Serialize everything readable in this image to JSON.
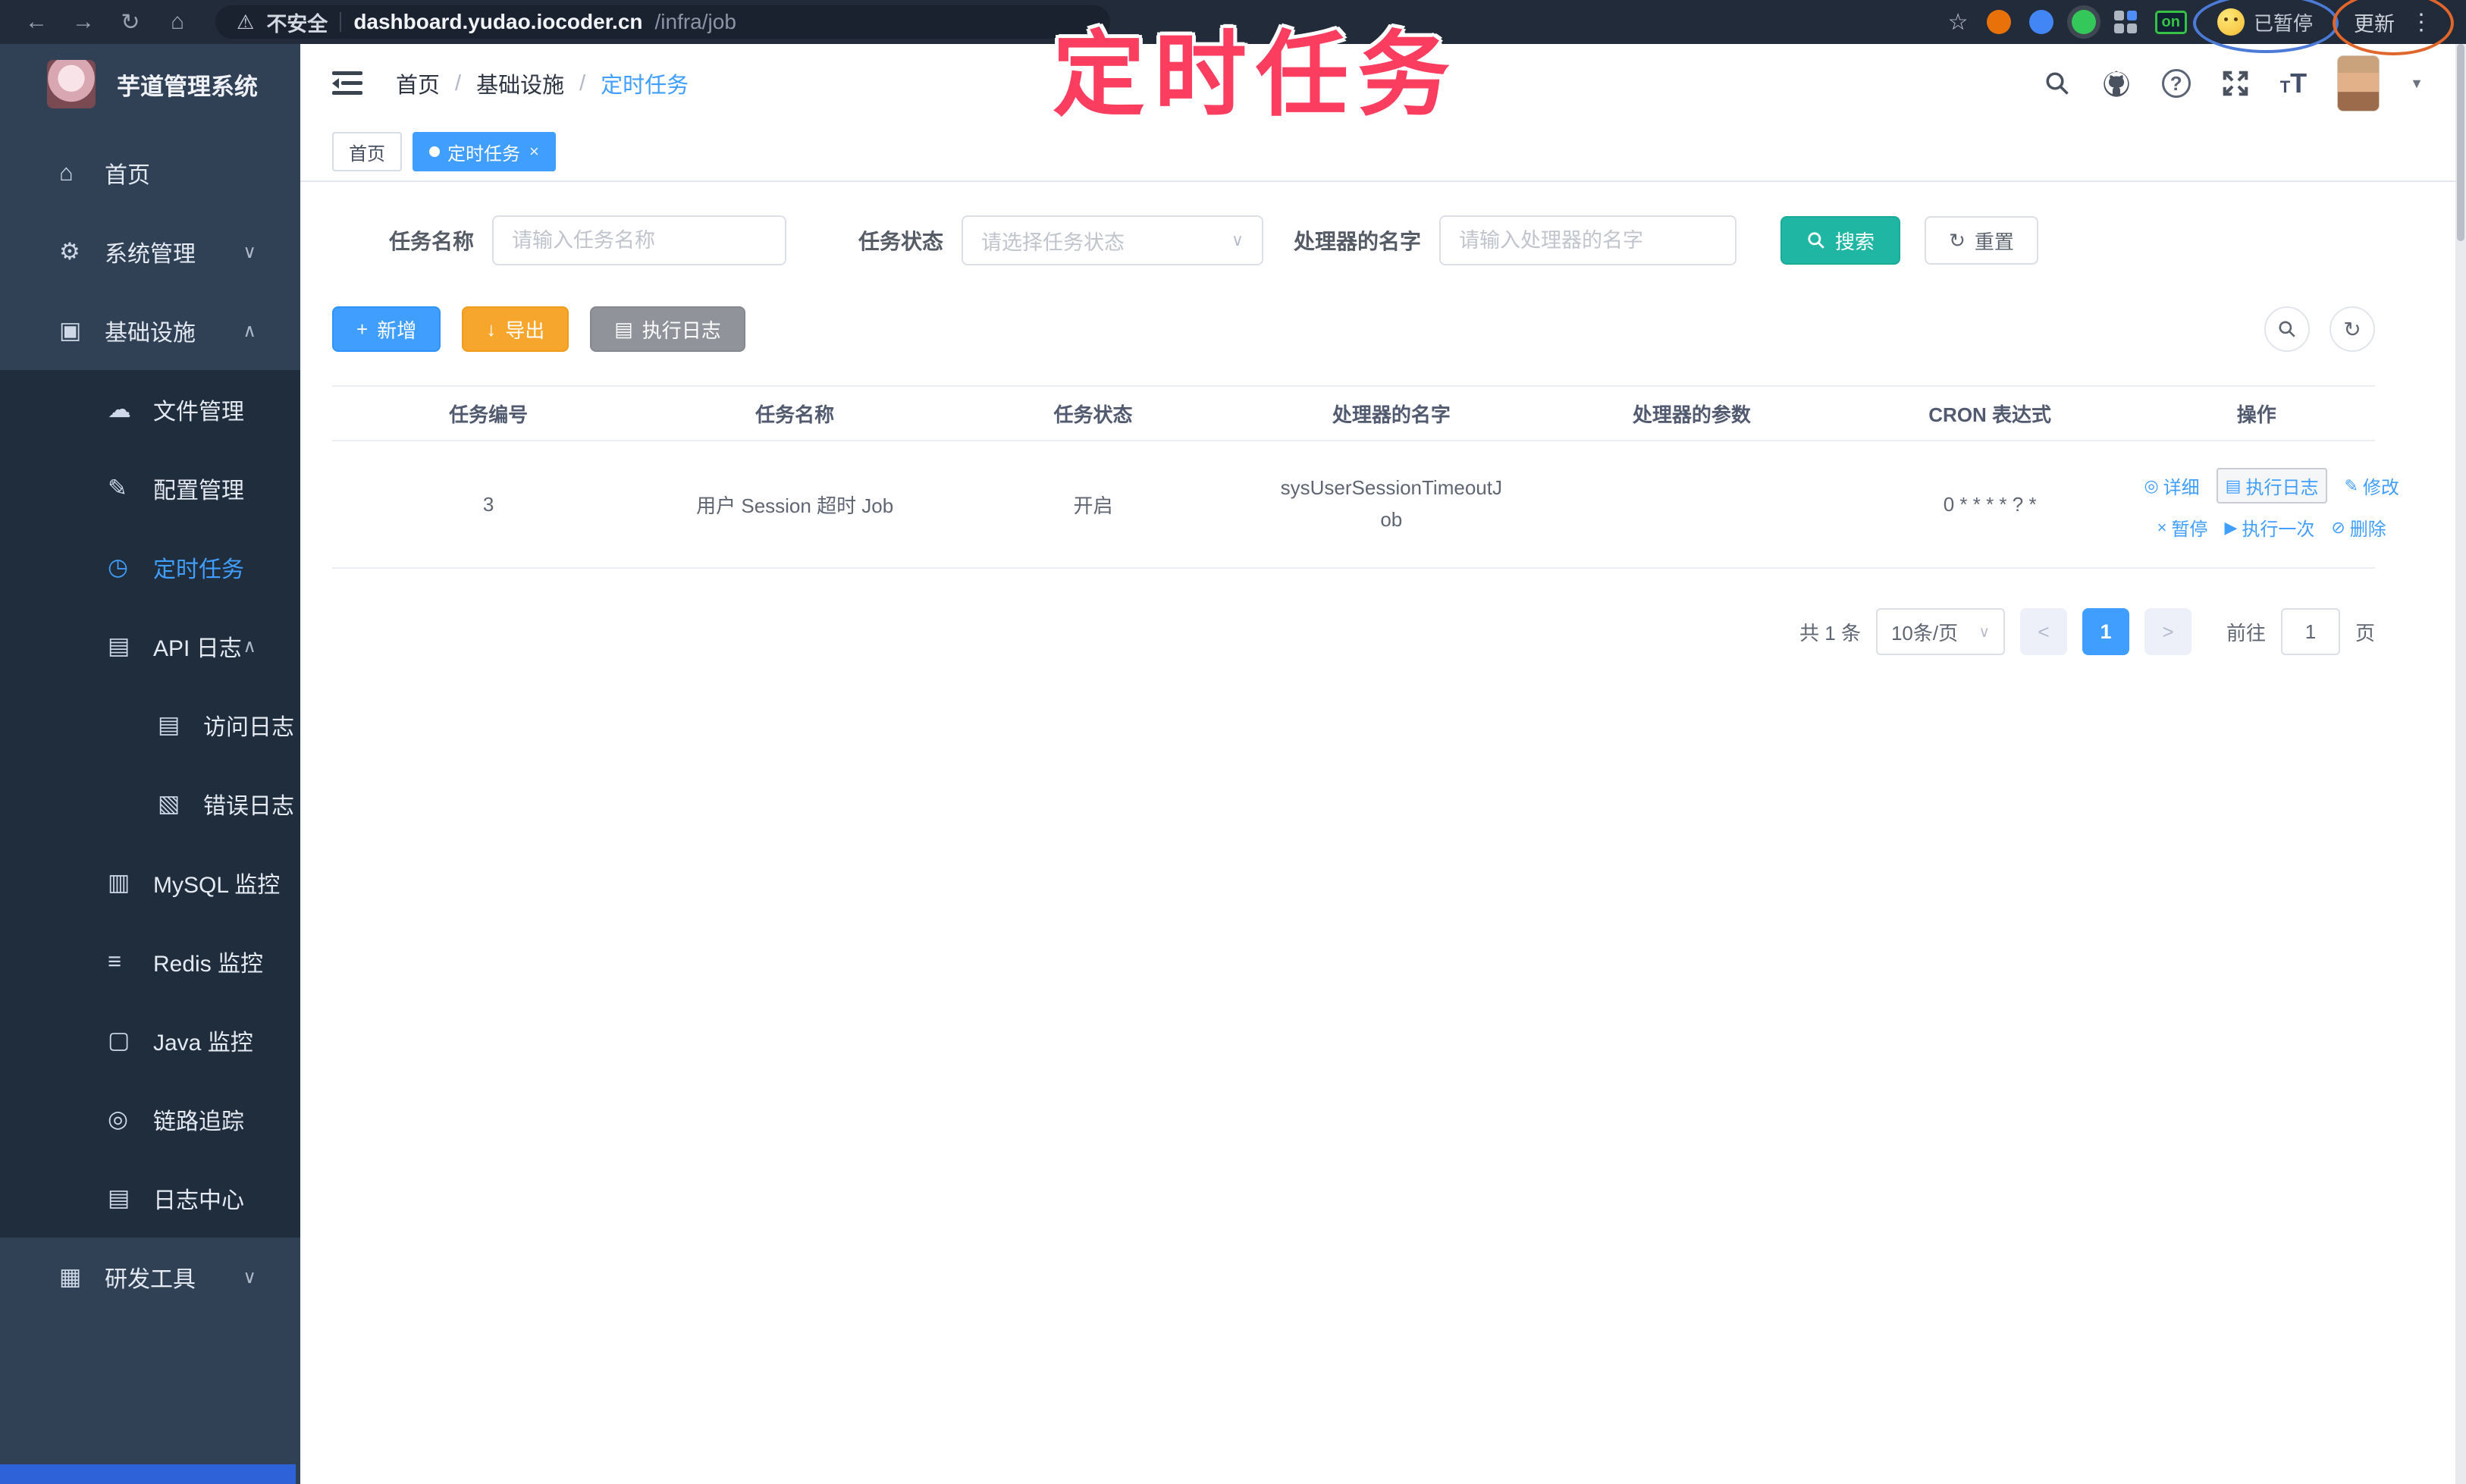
{
  "annotation": {
    "text": "定时任务",
    "color": "#fb3d60"
  },
  "browser": {
    "security_label": "不安全",
    "url_host": "dashboard.yudao.iocoder.cn",
    "url_path": "/infra/job",
    "extension_on_badge": "on",
    "paused_badge": "已暂停",
    "update_button": "更新"
  },
  "icons": {
    "back": "←",
    "forward": "→",
    "reload": "↻",
    "home": "⌂",
    "warning": "⚠",
    "star": "☆",
    "kebab": "⋮",
    "question": "?",
    "caret_down": "▼",
    "chevron_down": "∨",
    "chevron_up": "∧",
    "select_chevron": "∨",
    "plus": "+",
    "download": "↓",
    "list": "▤",
    "refresh": "↻",
    "t_small": "T",
    "t_big": "T",
    "pager_prev": "<",
    "pager_next": ">"
  },
  "sidebar": {
    "logo_title": "芋道管理系统",
    "items": [
      {
        "label": "首页",
        "glyph": "⌂",
        "chevron": ""
      },
      {
        "label": "系统管理",
        "glyph": "⚙",
        "chevron": "∨"
      },
      {
        "label": "基础设施",
        "glyph": "▣",
        "chevron": "∧"
      },
      {
        "label": "文件管理",
        "glyph": "☁",
        "chevron": ""
      },
      {
        "label": "配置管理",
        "glyph": "✎",
        "chevron": ""
      },
      {
        "label": "定时任务",
        "glyph": "◷",
        "chevron": ""
      },
      {
        "label": "API 日志",
        "glyph": "▤",
        "chevron": "∧"
      },
      {
        "label": "访问日志",
        "glyph": "▤",
        "chevron": ""
      },
      {
        "label": "错误日志",
        "glyph": "▧",
        "chevron": ""
      },
      {
        "label": "MySQL 监控",
        "glyph": "▥",
        "chevron": ""
      },
      {
        "label": "Redis 监控",
        "glyph": "≡",
        "chevron": ""
      },
      {
        "label": "Java 监控",
        "glyph": "▢",
        "chevron": ""
      },
      {
        "label": "链路追踪",
        "glyph": "◎",
        "chevron": ""
      },
      {
        "label": "日志中心",
        "glyph": "▤",
        "chevron": ""
      },
      {
        "label": "研发工具",
        "glyph": "▦",
        "chevron": "∨"
      }
    ]
  },
  "navbar": {
    "breadcrumb": [
      "首页",
      "基础设施",
      "定时任务"
    ],
    "separator": "/"
  },
  "tags": [
    {
      "label": "首页"
    },
    {
      "label": "定时任务",
      "close": "×"
    }
  ],
  "filters": {
    "name_label": "任务名称",
    "name_placeholder": "请输入任务名称",
    "status_label": "任务状态",
    "status_placeholder": "请选择任务状态",
    "handler_label": "处理器的名字",
    "handler_placeholder": "请输入处理器的名字",
    "search_label": "搜索",
    "reset_label": "重置"
  },
  "toolbar": {
    "add_label": "新增",
    "export_label": "导出",
    "log_label": "执行日志"
  },
  "table": {
    "columns": [
      "任务编号",
      "任务名称",
      "任务状态",
      "处理器的名字",
      "处理器的参数",
      "CRON 表达式",
      "操作"
    ],
    "rows": [
      {
        "id": "3",
        "name": "用户 Session 超时 Job",
        "status": "开启",
        "handler": "sysUserSessionTimeoutJob",
        "param": "",
        "cron": "0 * * * * ? *"
      }
    ],
    "row_actions": [
      {
        "label": "详细",
        "glyph": "◎"
      },
      {
        "label": "执行日志",
        "glyph": "▤"
      },
      {
        "label": "修改",
        "glyph": "✎"
      },
      {
        "label": "暂停",
        "glyph": "×"
      },
      {
        "label": "执行一次",
        "glyph": "▶"
      },
      {
        "label": "删除",
        "glyph": "⊘"
      }
    ]
  },
  "pagination": {
    "total": "共 1 条",
    "page_size": "10条/页",
    "current_page": "1",
    "goto_label": "前往",
    "goto_value": "1",
    "page_unit": "页"
  },
  "colors": {
    "primary": "#409eff",
    "search_teal": "#1fb7a4",
    "export_amber": "#f6a62c",
    "info_gray": "#909399",
    "sidebar_navy": "#304156",
    "submenu_navy": "#1f2d3d",
    "annotation_pink": "#fb3d60"
  }
}
